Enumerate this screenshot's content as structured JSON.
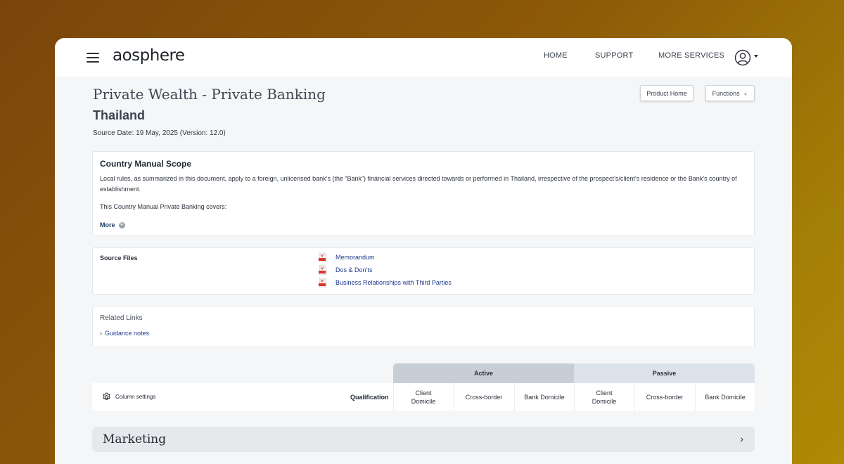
{
  "header": {
    "logo": "aosphere",
    "nav": [
      "HOME",
      "SUPPORT",
      "MORE SERVICES"
    ]
  },
  "page": {
    "title": "Private Wealth - Private Banking",
    "country": "Thailand",
    "source_date": "Source Date: 19 May, 2025 (Version: 12.0)",
    "product_home_label": "Product Home",
    "functions_label": "Functions"
  },
  "scope": {
    "heading": "Country Manual Scope",
    "paragraph": "Local rules, as summarized in this document, apply to a foreign, unlicensed bank’s (the “Bank”) financial services directed towards or performed in Thailand, irrespective of the prospect’s/client’s residence or the Bank’s country of establishment.",
    "covers": "This Country Manual Private Banking covers:",
    "more_label": "More"
  },
  "source_files": {
    "label": "Source Files",
    "files": [
      "Memorandum",
      "Dos & Don’ts",
      "Business Relationships with Third Parties"
    ]
  },
  "related_links": {
    "label": "Related Links",
    "links": [
      "Guidance notes"
    ]
  },
  "table": {
    "column_settings_label": "Column settings",
    "qualification_label": "Qualification",
    "groups": [
      "Active",
      "Passive"
    ],
    "columns": [
      "Client Domicile",
      "Cross-border",
      "Bank Domicile",
      "Client Domicile",
      "Cross-border",
      "Bank Domicile"
    ]
  },
  "sections": {
    "marketing": "Marketing"
  },
  "colors": {
    "background_start": "#7a450b",
    "background_end": "#b08a05",
    "link": "#1d3a8a",
    "active_header": "#c8ced6",
    "passive_header": "#dce2ea"
  }
}
